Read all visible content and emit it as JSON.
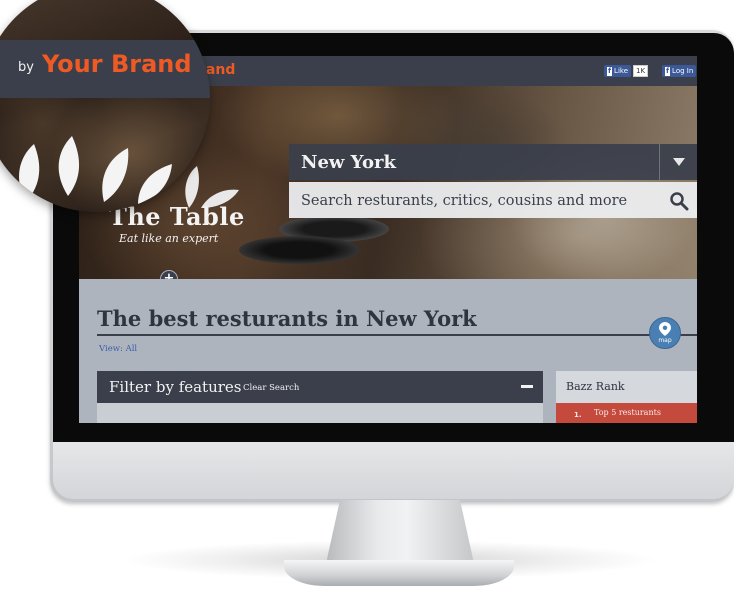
{
  "topbar": {
    "brand_partial": "rand",
    "fb_like_label": "Like",
    "fb_like_count": "1K",
    "fb_login_label": "Log In"
  },
  "hero": {
    "city": "New York",
    "search_placeholder": "Search resturants, critics, cousins and more",
    "logo_text": "The Table",
    "tagline": "Eat like an expert"
  },
  "content": {
    "heading": "The best resturants in New York",
    "view_all": "View: All",
    "map_label": "map",
    "filter_title": "Filter by features",
    "clear_search": "Clear Search",
    "bazz_rank": "Bazz Rank",
    "top5_label": "Top 5 resturants",
    "top5_number": "1."
  },
  "magnifier": {
    "by": "by",
    "brand": "Your Brand"
  },
  "colors": {
    "accent": "#ef5a24",
    "bar": "#3a3f4b",
    "rank_red": "#c44a3d",
    "map_blue": "#4a7fb3"
  }
}
